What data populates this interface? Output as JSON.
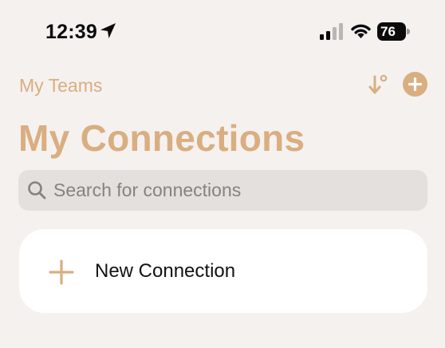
{
  "status_bar": {
    "time": "12:39",
    "battery_level": "76",
    "location_icon": "location-arrow-icon",
    "signal_icon": "cellular-signal-icon",
    "wifi_icon": "wifi-icon"
  },
  "nav": {
    "back_label": "My Teams",
    "sort_icon": "sort-down-icon",
    "add_icon": "plus-circle-icon"
  },
  "page": {
    "title": "My Connections"
  },
  "search": {
    "placeholder": "Search for connections",
    "value": "",
    "icon": "search-icon"
  },
  "card": {
    "label": "New Connection",
    "icon": "plus-icon"
  },
  "colors": {
    "accent": "#d9ae80",
    "background": "#f5f1ef",
    "search_background": "#e4e0de",
    "card_background": "#ffffff"
  }
}
